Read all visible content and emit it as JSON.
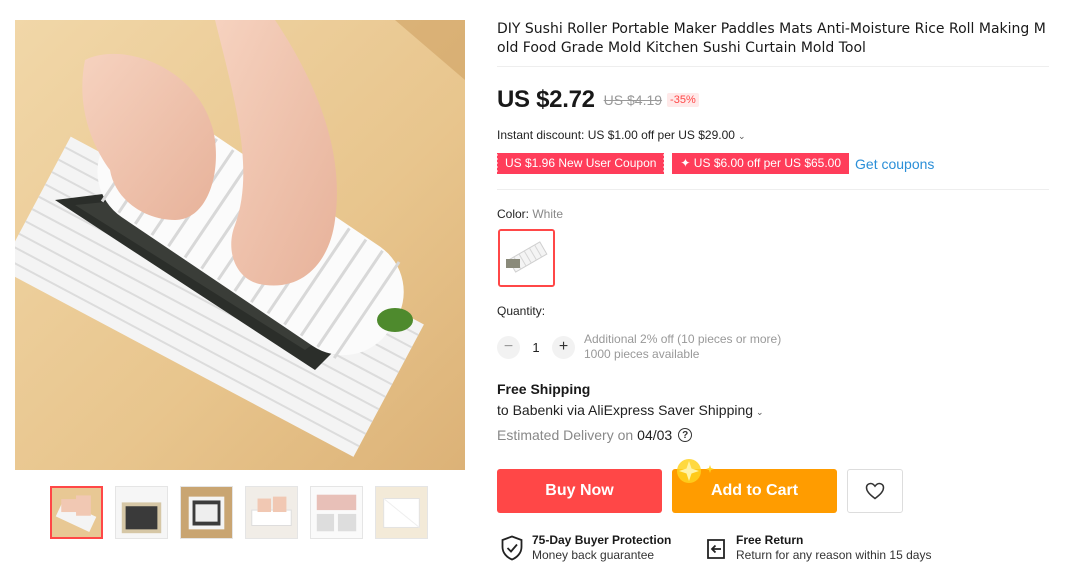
{
  "product": {
    "title": "DIY Sushi Roller Portable Maker Paddles Mats Anti-Moisture Rice Roll Making Mold Food Grade Mold Kitchen Sushi Curtain Mold Tool",
    "price": "US $2.72",
    "price_original": "US $4.19",
    "discount": "-35%",
    "instant_discount": "Instant discount: US $1.00 off per US $29.00",
    "coupons": {
      "new_user": "US $1.96 New User Coupon",
      "store": "✦ US $6.00 off per US $65.00",
      "get_link": "Get coupons"
    },
    "color": {
      "label": "Color:",
      "value": "White"
    },
    "quantity": {
      "label": "Quantity:",
      "minus": "−",
      "plus": "+",
      "value": "1",
      "note_line1": "Additional 2% off (10 pieces or more)",
      "note_line2": "1000 pieces available"
    },
    "shipping": {
      "title": "Free Shipping",
      "to": "to Babenki via AliExpress Saver Shipping",
      "delivery_label": "Estimated Delivery on",
      "delivery_date": "04/03",
      "help": "?"
    },
    "actions": {
      "buy_now": "Buy Now",
      "add_to_cart": "Add to Cart"
    },
    "guarantees": [
      {
        "title": "75-Day Buyer Protection",
        "subtitle": "Money back guarantee"
      },
      {
        "title": "Free Return",
        "subtitle": "Return for any reason within 15 days"
      }
    ]
  },
  "colors": {
    "accent_red": "#ff4747",
    "accent_orange": "#ff9c00",
    "link_blue": "#2b8fd8",
    "coupon_pink": "#ff3d5a"
  },
  "icons": {
    "chevron": "chevron-down-icon",
    "heart": "heart-icon",
    "shield": "shield-check-icon",
    "return": "return-arrow-icon"
  }
}
